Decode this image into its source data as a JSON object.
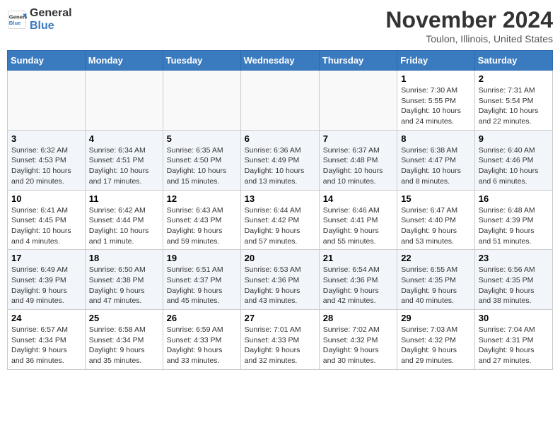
{
  "header": {
    "logo_line1": "General",
    "logo_line2": "Blue",
    "month_title": "November 2024",
    "location": "Toulon, Illinois, United States"
  },
  "weekdays": [
    "Sunday",
    "Monday",
    "Tuesday",
    "Wednesday",
    "Thursday",
    "Friday",
    "Saturday"
  ],
  "weeks": [
    [
      {
        "day": "",
        "info": ""
      },
      {
        "day": "",
        "info": ""
      },
      {
        "day": "",
        "info": ""
      },
      {
        "day": "",
        "info": ""
      },
      {
        "day": "",
        "info": ""
      },
      {
        "day": "1",
        "info": "Sunrise: 7:30 AM\nSunset: 5:55 PM\nDaylight: 10 hours\nand 24 minutes."
      },
      {
        "day": "2",
        "info": "Sunrise: 7:31 AM\nSunset: 5:54 PM\nDaylight: 10 hours\nand 22 minutes."
      }
    ],
    [
      {
        "day": "3",
        "info": "Sunrise: 6:32 AM\nSunset: 4:53 PM\nDaylight: 10 hours\nand 20 minutes."
      },
      {
        "day": "4",
        "info": "Sunrise: 6:34 AM\nSunset: 4:51 PM\nDaylight: 10 hours\nand 17 minutes."
      },
      {
        "day": "5",
        "info": "Sunrise: 6:35 AM\nSunset: 4:50 PM\nDaylight: 10 hours\nand 15 minutes."
      },
      {
        "day": "6",
        "info": "Sunrise: 6:36 AM\nSunset: 4:49 PM\nDaylight: 10 hours\nand 13 minutes."
      },
      {
        "day": "7",
        "info": "Sunrise: 6:37 AM\nSunset: 4:48 PM\nDaylight: 10 hours\nand 10 minutes."
      },
      {
        "day": "8",
        "info": "Sunrise: 6:38 AM\nSunset: 4:47 PM\nDaylight: 10 hours\nand 8 minutes."
      },
      {
        "day": "9",
        "info": "Sunrise: 6:40 AM\nSunset: 4:46 PM\nDaylight: 10 hours\nand 6 minutes."
      }
    ],
    [
      {
        "day": "10",
        "info": "Sunrise: 6:41 AM\nSunset: 4:45 PM\nDaylight: 10 hours\nand 4 minutes."
      },
      {
        "day": "11",
        "info": "Sunrise: 6:42 AM\nSunset: 4:44 PM\nDaylight: 10 hours\nand 1 minute."
      },
      {
        "day": "12",
        "info": "Sunrise: 6:43 AM\nSunset: 4:43 PM\nDaylight: 9 hours\nand 59 minutes."
      },
      {
        "day": "13",
        "info": "Sunrise: 6:44 AM\nSunset: 4:42 PM\nDaylight: 9 hours\nand 57 minutes."
      },
      {
        "day": "14",
        "info": "Sunrise: 6:46 AM\nSunset: 4:41 PM\nDaylight: 9 hours\nand 55 minutes."
      },
      {
        "day": "15",
        "info": "Sunrise: 6:47 AM\nSunset: 4:40 PM\nDaylight: 9 hours\nand 53 minutes."
      },
      {
        "day": "16",
        "info": "Sunrise: 6:48 AM\nSunset: 4:39 PM\nDaylight: 9 hours\nand 51 minutes."
      }
    ],
    [
      {
        "day": "17",
        "info": "Sunrise: 6:49 AM\nSunset: 4:39 PM\nDaylight: 9 hours\nand 49 minutes."
      },
      {
        "day": "18",
        "info": "Sunrise: 6:50 AM\nSunset: 4:38 PM\nDaylight: 9 hours\nand 47 minutes."
      },
      {
        "day": "19",
        "info": "Sunrise: 6:51 AM\nSunset: 4:37 PM\nDaylight: 9 hours\nand 45 minutes."
      },
      {
        "day": "20",
        "info": "Sunrise: 6:53 AM\nSunset: 4:36 PM\nDaylight: 9 hours\nand 43 minutes."
      },
      {
        "day": "21",
        "info": "Sunrise: 6:54 AM\nSunset: 4:36 PM\nDaylight: 9 hours\nand 42 minutes."
      },
      {
        "day": "22",
        "info": "Sunrise: 6:55 AM\nSunset: 4:35 PM\nDaylight: 9 hours\nand 40 minutes."
      },
      {
        "day": "23",
        "info": "Sunrise: 6:56 AM\nSunset: 4:35 PM\nDaylight: 9 hours\nand 38 minutes."
      }
    ],
    [
      {
        "day": "24",
        "info": "Sunrise: 6:57 AM\nSunset: 4:34 PM\nDaylight: 9 hours\nand 36 minutes."
      },
      {
        "day": "25",
        "info": "Sunrise: 6:58 AM\nSunset: 4:34 PM\nDaylight: 9 hours\nand 35 minutes."
      },
      {
        "day": "26",
        "info": "Sunrise: 6:59 AM\nSunset: 4:33 PM\nDaylight: 9 hours\nand 33 minutes."
      },
      {
        "day": "27",
        "info": "Sunrise: 7:01 AM\nSunset: 4:33 PM\nDaylight: 9 hours\nand 32 minutes."
      },
      {
        "day": "28",
        "info": "Sunrise: 7:02 AM\nSunset: 4:32 PM\nDaylight: 9 hours\nand 30 minutes."
      },
      {
        "day": "29",
        "info": "Sunrise: 7:03 AM\nSunset: 4:32 PM\nDaylight: 9 hours\nand 29 minutes."
      },
      {
        "day": "30",
        "info": "Sunrise: 7:04 AM\nSunset: 4:31 PM\nDaylight: 9 hours\nand 27 minutes."
      }
    ]
  ]
}
